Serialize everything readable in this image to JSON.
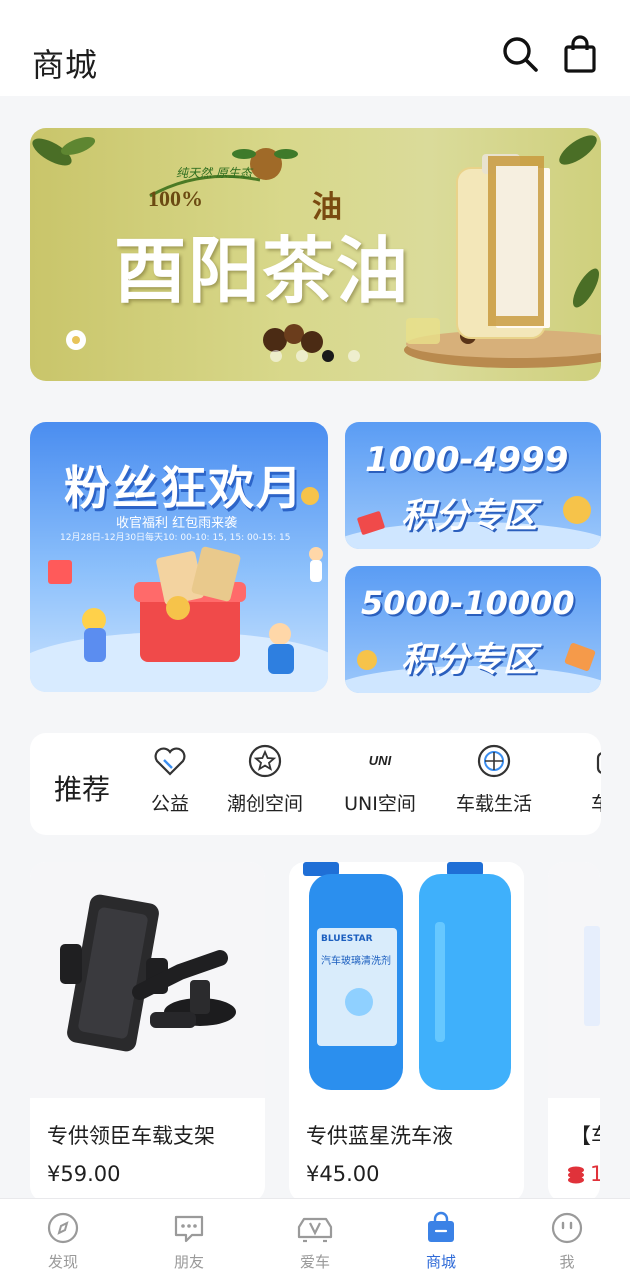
{
  "header": {
    "title": "商城",
    "icons": [
      "search-icon",
      "shopping-bag-icon"
    ]
  },
  "banner": {
    "title": "酉阳茶油",
    "small_text": "纯天然 原生态",
    "percent_text": "100%",
    "product_char": "油",
    "dots": 4,
    "active_dot": 2
  },
  "promos": {
    "fan": {
      "title": "粉丝狂欢月",
      "subtitle": "收官福利 红包雨来袭",
      "schedule": "12月28日-12月30日每天10: 00-10: 15, 15: 00-15: 15"
    },
    "points1": {
      "range": "1000-4999",
      "zone": "积分专区"
    },
    "points2": {
      "range": "5000-10000",
      "zone": "积分专区"
    }
  },
  "categories": {
    "heading": "推荐",
    "items": [
      {
        "label": "公益",
        "icon": "heart-icon"
      },
      {
        "label": "潮创空间",
        "icon": "star-badge-icon"
      },
      {
        "label": "UNI空间",
        "icon": "uni-logo-icon",
        "logo_text": "UNI"
      },
      {
        "label": "车载生活",
        "icon": "wheel-icon"
      },
      {
        "label": "车模",
        "icon": "car-model-icon"
      }
    ]
  },
  "products": [
    {
      "name": "专供领臣车载支架",
      "price": "¥59.00"
    },
    {
      "name": "专供蓝星洗车液",
      "price": "¥45.00",
      "brand_text": "BLUESTAR",
      "bottle_label": "汽车玻璃清洗剂"
    },
    {
      "name": "【车",
      "price": "1"
    }
  ],
  "tabbar": {
    "items": [
      {
        "label": "发现",
        "icon": "compass-icon"
      },
      {
        "label": "朋友",
        "icon": "chat-icon"
      },
      {
        "label": "爱车",
        "icon": "car-icon"
      },
      {
        "label": "商城",
        "icon": "shop-bag-icon"
      },
      {
        "label": "我",
        "icon": "face-icon"
      }
    ],
    "active_index": 3,
    "active_color": "#2f6bd8",
    "inactive_color": "#9a9a9a"
  }
}
